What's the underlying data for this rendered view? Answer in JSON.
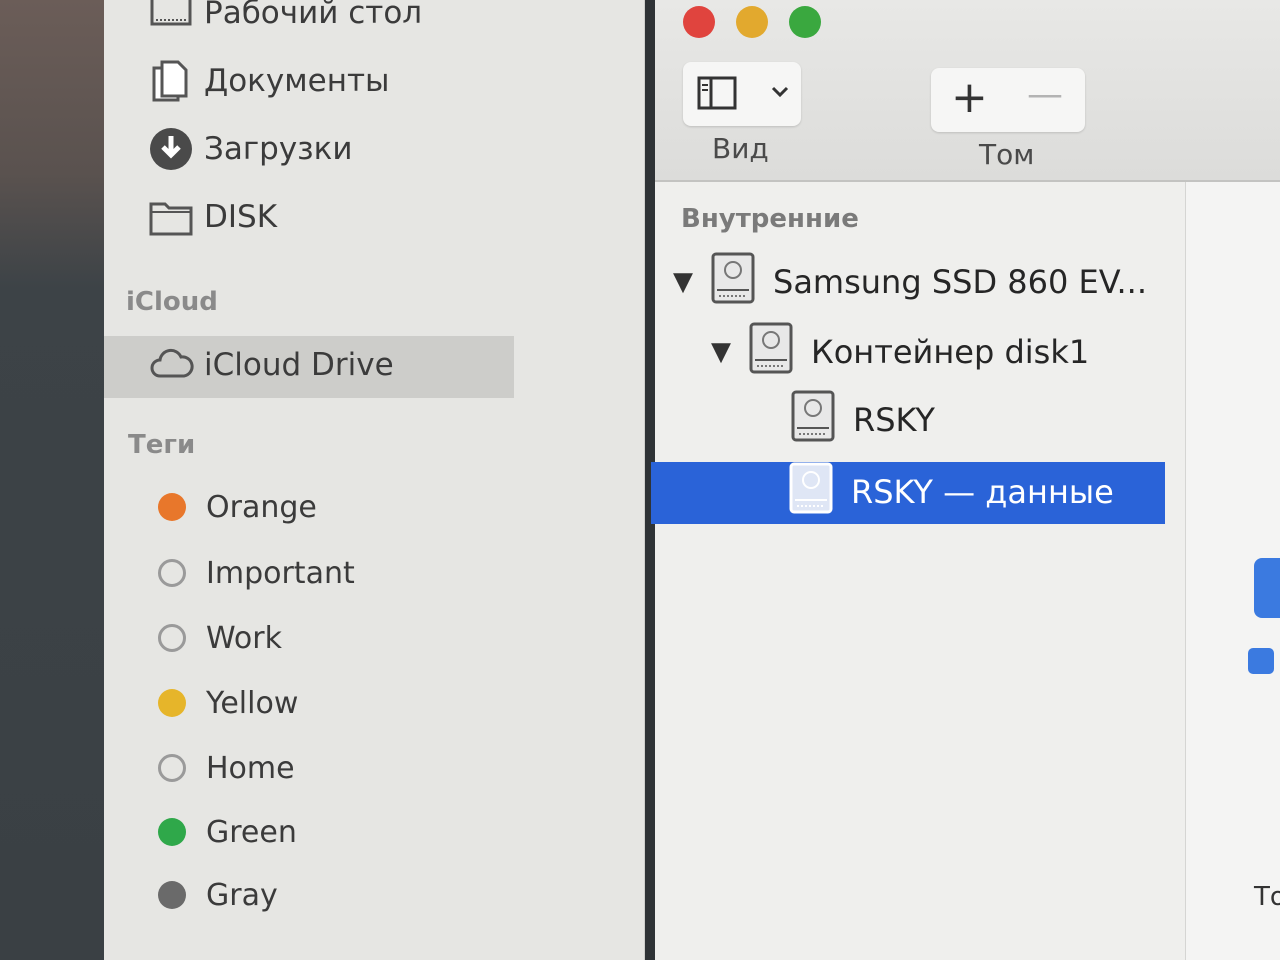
{
  "sidebar": {
    "favorites": [
      {
        "label": "Рабочий стол",
        "icon": "desktop-icon"
      },
      {
        "label": "Документы",
        "icon": "documents-icon"
      },
      {
        "label": "Загрузки",
        "icon": "downloads-icon"
      },
      {
        "label": "DISK",
        "icon": "folder-icon"
      }
    ],
    "icloud_heading": "iCloud",
    "icloud_drive": {
      "label": "iCloud Drive",
      "icon": "cloud-icon"
    },
    "tags_heading": "Теги",
    "tags": [
      {
        "label": "Orange",
        "color": "#e8772b"
      },
      {
        "label": "Important",
        "color": "none"
      },
      {
        "label": "Work",
        "color": "none"
      },
      {
        "label": "Yellow",
        "color": "#e6b52a"
      },
      {
        "label": "Home",
        "color": "none"
      },
      {
        "label": "Green",
        "color": "#2fa84a"
      },
      {
        "label": "Gray",
        "color": "#6a6a6a"
      }
    ]
  },
  "disk_utility": {
    "toolbar": {
      "view_label": "Вид",
      "volume_label": "Том",
      "add_symbol": "+",
      "remove_symbol": "—"
    },
    "section_internal": "Внутренние",
    "items": [
      {
        "label": "Samsung SSD 860 EV...",
        "level": 0,
        "expanded": true
      },
      {
        "label": "Контейнер disk1",
        "level": 1,
        "expanded": true
      },
      {
        "label": "RSKY",
        "level": 2
      },
      {
        "label": "RSKY — данные",
        "level": 2,
        "selected": true
      }
    ],
    "detail_fragment": "То"
  },
  "colors": {
    "selection": "#2a63d8",
    "close": "#e0443e",
    "minimize": "#e2a92e",
    "zoom": "#3aa83f"
  }
}
